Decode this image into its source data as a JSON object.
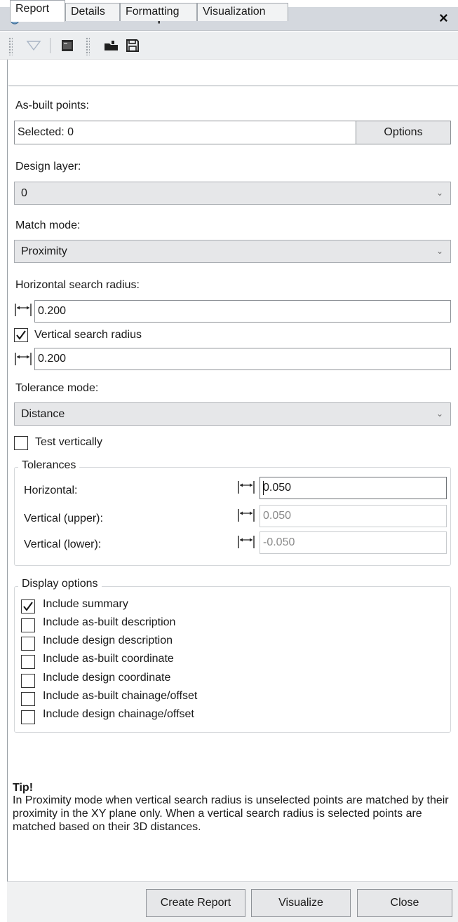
{
  "window": {
    "title": "Point Conformance Report",
    "close_glyph": "×"
  },
  "toolbar": {
    "icons": [
      "filter-icon",
      "terminal-icon",
      "open-folder-icon",
      "save-icon"
    ]
  },
  "tabs": [
    {
      "label": "Report",
      "active": true
    },
    {
      "label": "Details",
      "active": false
    },
    {
      "label": "Formatting",
      "active": false
    },
    {
      "label": "Visualization",
      "active": false
    }
  ],
  "report": {
    "asbuilt_label": "As-built points:",
    "asbuilt_value": "Selected: 0",
    "options_button": "Options",
    "design_layer_label": "Design layer:",
    "design_layer_value": "0",
    "match_mode_label": "Match mode:",
    "match_mode_value": "Proximity",
    "hsearch_label": "Horizontal search radius:",
    "hsearch_value": "0.200",
    "vsearch_label": "Vertical search radius",
    "vsearch_checked": true,
    "vsearch_value": "0.200",
    "tolerance_mode_label": "Tolerance mode:",
    "tolerance_mode_value": "Distance",
    "test_vertically_label": "Test vertically",
    "test_vertically_checked": false
  },
  "tolerances": {
    "title": "Tolerances",
    "horizontal_label": "Horizontal:",
    "horizontal_value": "0.050",
    "vupper_label": "Vertical (upper):",
    "vupper_value": "0.050",
    "vlower_label": "Vertical (lower):",
    "vlower_value": "-0.050"
  },
  "display_options": {
    "title": "Display options",
    "items": [
      {
        "label": "Include summary",
        "checked": true
      },
      {
        "label": "Include as-built description",
        "checked": false
      },
      {
        "label": "Include design description",
        "checked": false
      },
      {
        "label": "Include as-built coordinate",
        "checked": false
      },
      {
        "label": "Include design coordinate",
        "checked": false
      },
      {
        "label": "Include as-built chainage/offset",
        "checked": false
      },
      {
        "label": "Include design chainage/offset",
        "checked": false
      }
    ]
  },
  "tip": {
    "title": "Tip!",
    "text": "In Proximity mode when vertical search radius is unselected points are matched by their proximity in the XY plane only. When a vertical search radius is selected points are matched based on their 3D distances."
  },
  "footer": {
    "create_report": "Create Report",
    "visualize": "Visualize",
    "close": "Close"
  },
  "colors": {
    "titlebar": "#d4d8de",
    "toolbar": "#eceef0",
    "button": "#e6e7e9",
    "border": "#8e9297"
  }
}
